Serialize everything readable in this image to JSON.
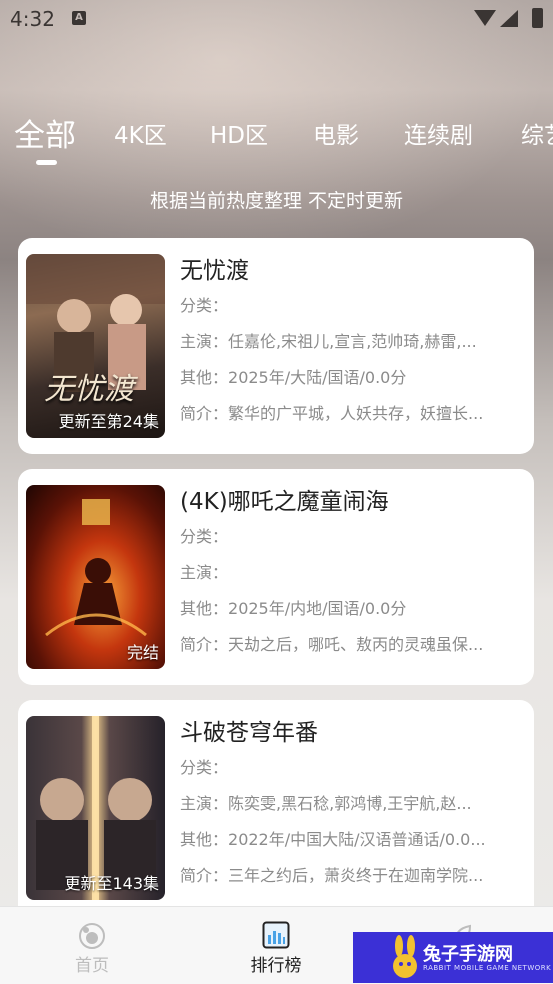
{
  "status_bar": {
    "time": "4:32",
    "notif_letter": "A"
  },
  "tabs": [
    {
      "label": "全部",
      "active": true
    },
    {
      "label": "4K区",
      "active": false
    },
    {
      "label": "HD区",
      "active": false
    },
    {
      "label": "电影",
      "active": false
    },
    {
      "label": "连续剧",
      "active": false
    },
    {
      "label": "综艺",
      "active": false
    }
  ],
  "subtitle": "根据当前热度整理 不定时更新",
  "items": [
    {
      "title": "无忧渡",
      "badge": "更新至第24集",
      "poster_text": "无忧渡",
      "category_label": "分类：",
      "category": "",
      "cast_label": "主演：",
      "cast": "任嘉伦,宋祖儿,宣言,范帅琦,赫雷,...",
      "other_label": "其他：",
      "other": "2025年/大陆/国语/0.0分",
      "intro_label": "简介：",
      "intro": "繁华的广平城，人妖共存，妖擅长...",
      "colors": [
        "#3b2e29",
        "#7a5a44",
        "#c9a88a"
      ]
    },
    {
      "title": "(4K)哪吒之魔童闹海",
      "badge": "完结",
      "poster_text": "",
      "category_label": "分类：",
      "category": "",
      "cast_label": "主演：",
      "cast": "",
      "other_label": "其他：",
      "other": "2025年/内地/国语/0.0分",
      "intro_label": "简介：",
      "intro": "天劫之后，哪吒、敖丙的灵魂虽保...",
      "colors": [
        "#2a0b05",
        "#b3340f",
        "#f08a24"
      ]
    },
    {
      "title": "斗破苍穹年番",
      "badge": "更新至143集",
      "poster_text": "",
      "category_label": "分类：",
      "category": "",
      "cast_label": "主演：",
      "cast": "陈奕雯,黑石稔,郭鸿博,王宇航,赵...",
      "other_label": "其他：",
      "other": "2022年/中国大陆/汉语普通话/0.0...",
      "intro_label": "简介：",
      "intro": "三年之约后，萧炎终于在迦南学院...",
      "colors": [
        "#1e1c22",
        "#4a3a3a",
        "#e3c48a"
      ]
    }
  ],
  "bottom_nav": [
    {
      "label": "首页",
      "icon": "home-icon",
      "active": false
    },
    {
      "label": "排行榜",
      "icon": "ranking-icon",
      "active": true
    },
    {
      "label": "",
      "icon": "leaf-icon",
      "active": false
    }
  ],
  "promo": {
    "title": "兔子手游网",
    "subtitle": "RABBIT MOBILE GAME NETWORK"
  },
  "colors": {
    "active_nav": "#222222",
    "inactive_nav": "#bdbdbd",
    "accent_blue": "#4aa3e6",
    "promo_bg": "#3b30d6"
  }
}
